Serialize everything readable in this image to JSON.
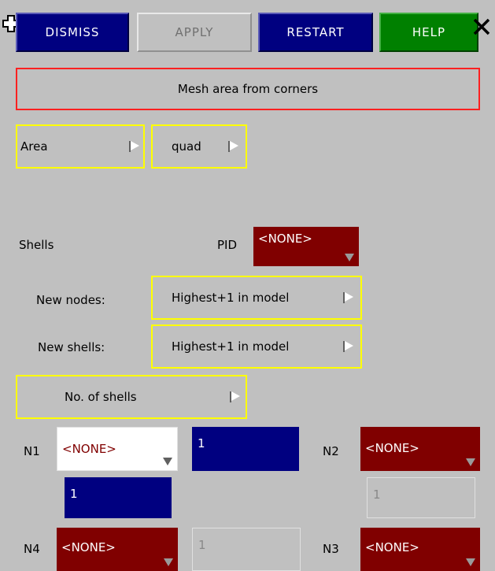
{
  "toolbar": {
    "dismiss_label": "DISMISS",
    "apply_label": "APPLY",
    "restart_label": "RESTART",
    "help_label": "HELP"
  },
  "panel_title": "Mesh area from corners",
  "mode": {
    "area_label": "Area",
    "element_type_label": "quad"
  },
  "shells": {
    "label": "Shells",
    "pid_label": "PID",
    "pid_value": "<NONE>"
  },
  "new_nodes": {
    "label": "New nodes:",
    "value": "Highest+1 in model"
  },
  "new_shells": {
    "label": "New shells:",
    "value": "Highest+1 in model"
  },
  "no_of_shells_label": "No. of shells",
  "nodes": {
    "n1": {
      "label": "N1",
      "value": "<NONE>"
    },
    "n2": {
      "label": "N2",
      "value": "<NONE>"
    },
    "n3": {
      "label": "N3",
      "value": "<NONE>"
    },
    "n4": {
      "label": "N4",
      "value": "<NONE>"
    }
  },
  "counts": {
    "n1_n2": "1",
    "n1_n4": "1",
    "n2_n3": "1",
    "n4_n3": "1"
  },
  "colors": {
    "background": "#c0c0c0",
    "navy": "#000080",
    "help_green": "#008000",
    "dropdown_dark": "#800000",
    "title_border": "#ff0000",
    "option_border": "#ffff00"
  }
}
